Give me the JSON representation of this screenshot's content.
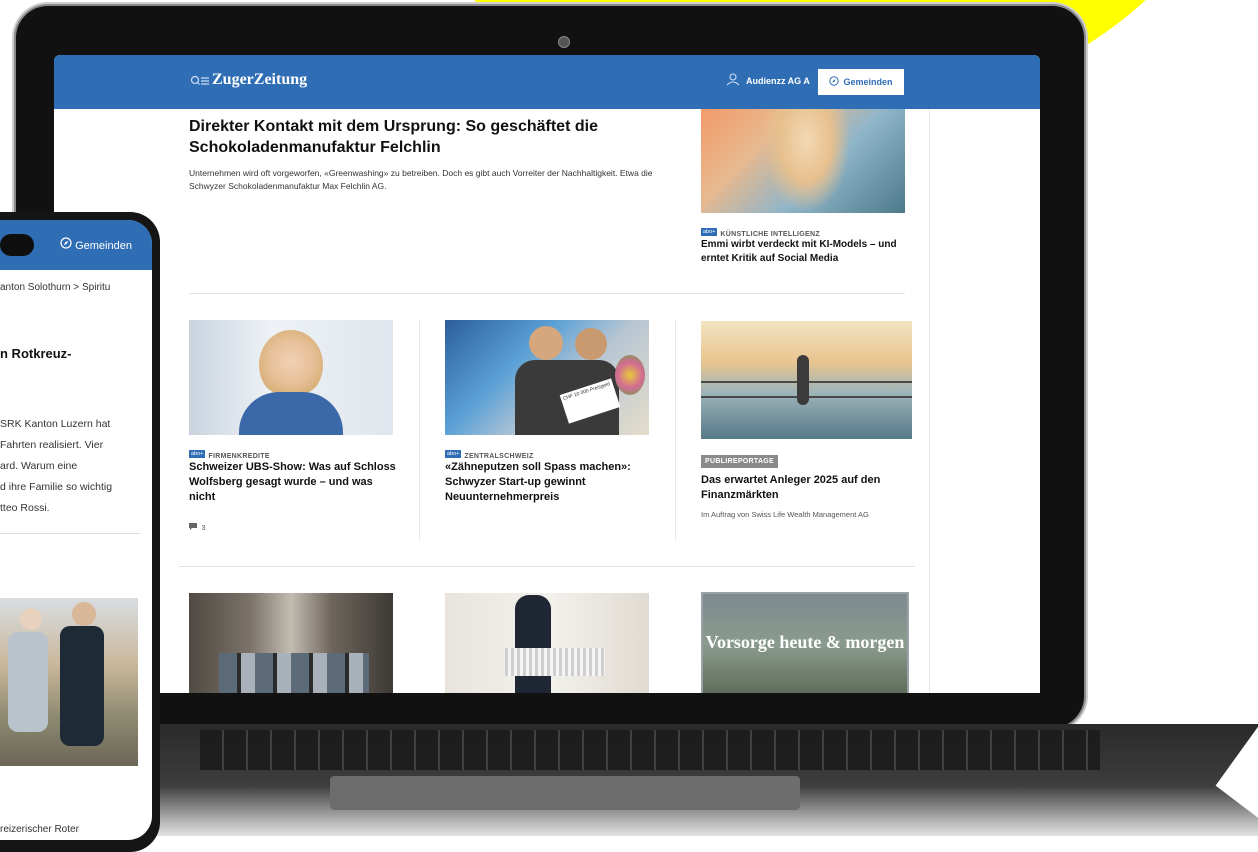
{
  "site": {
    "logo": "ZugerZeitung",
    "user_label": "Audienzz AG A",
    "gemeinden_label": "Gemeinden"
  },
  "lead": {
    "title": "Direkter Kontakt mit dem Ursprung: So geschäftet die Schokoladenmanufaktur Felchlin",
    "text": "Unternehmen wird oft vorgeworfen, «Greenwashing» zu betreiben. Doch es gibt auch Vorreiter der Nachhaltigkeit. Etwa die Schwyzer Schokoladenmanufaktur Max Felchlin AG."
  },
  "side_article": {
    "abo": "abo+",
    "tag": "KÜNSTLICHE INTELLIGENZ",
    "title": "Emmi wirbt verdeckt mit KI-Models – und erntet Kritik auf Social Media"
  },
  "cards": [
    {
      "abo": "abo+",
      "tag": "FIRMENKREDITE",
      "title": "Schweizer UBS-Show: Was auf Schloss Wolfsberg gesagt wurde – und was nicht",
      "comments": "3"
    },
    {
      "abo": "abo+",
      "tag": "ZENTRALSCHWEIZ",
      "title": "«Zähneputzen soll Spass machen»: Schwyzer Start-up gewinnt Neuunternehmerpreis",
      "check_text": "CHF 10 000 Preisgeld"
    },
    {
      "badge": "PUBLIREPORTAGE",
      "title": "Das erwartet Anleger 2025 auf den Finanzmärkten",
      "sub": "Im Auftrag von Swiss Life Wealth Management AG"
    }
  ],
  "promo": {
    "text": "Vorsorge heute & morgen"
  },
  "phone": {
    "gemeinden_label": "Gemeinden",
    "breadcrumb": "anton Solothurn  >  Spiritu",
    "title": "n Rotkreuz-",
    "text_lines": [
      "SRK Kanton Luzern hat",
      "Fahrten realisiert. Vier",
      "ard. Warum eine",
      "d ihre Familie so wichtig",
      "tteo Rossi."
    ],
    "bottom_text": "reizerischer Roter"
  },
  "icons": [
    "search-icon",
    "menu-icon",
    "user-icon",
    "compass-icon",
    "comment-icon"
  ],
  "colors": {
    "brand_blue": "#2f6db5",
    "background_yellow": "#ffff00"
  }
}
